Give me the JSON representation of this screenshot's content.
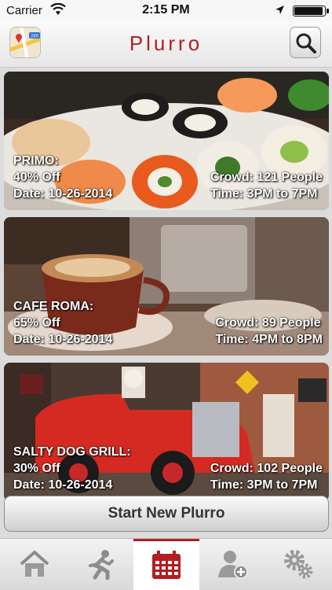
{
  "status_bar": {
    "carrier": "Carrier",
    "time": "2:15 PM"
  },
  "header": {
    "title": "Plurro",
    "maps_icon": "maps-app-icon",
    "search_icon": "search-icon"
  },
  "deals": [
    {
      "name": "PRIMO:",
      "discount": "40% Off",
      "date": "Date: 10-26-2014",
      "crowd": "Crowd: 121 People",
      "time": "Time: 3PM to 7PM",
      "image": "sushi-photo"
    },
    {
      "name": "CAFE ROMA:",
      "discount": "65% Off",
      "date": "Date: 10-26-2014",
      "crowd": "Crowd: 89 People",
      "time": "Time: 4PM to 8PM",
      "image": "coffee-photo"
    },
    {
      "name": "SALTY DOG GRILL:",
      "discount": "30% Off",
      "date": "Date: 10-26-2014",
      "crowd": "Crowd: 102 People",
      "time": "Time: 3PM to 7PM",
      "image": "fire-truck-photo"
    }
  ],
  "start_button": "Start New Plurro",
  "tabs": [
    {
      "icon": "home-icon"
    },
    {
      "icon": "runner-icon"
    },
    {
      "icon": "calendar-icon",
      "active": true
    },
    {
      "icon": "add-user-icon"
    },
    {
      "icon": "settings-gears-icon"
    }
  ],
  "colors": {
    "brand_red": "#b21e22",
    "active_tab": "#ffffff"
  }
}
